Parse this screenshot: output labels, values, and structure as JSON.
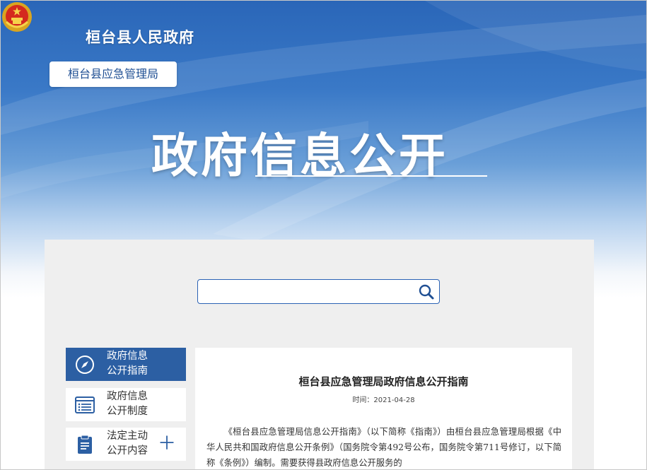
{
  "header": {
    "gov_name": "桓台县人民政府",
    "dept_name": "桓台县应急管理局",
    "hero_title": "政府信息公开"
  },
  "search": {
    "placeholder": "",
    "value": ""
  },
  "sidebar": {
    "items": [
      {
        "label": "政府信息公开指南",
        "icon": "compass-icon",
        "active": true
      },
      {
        "label": "政府信息公开制度",
        "icon": "list-icon",
        "active": false
      },
      {
        "label": "法定主动公开内容",
        "icon": "clipboard-icon",
        "active": false,
        "expand": "＋"
      }
    ]
  },
  "article": {
    "title": "桓台县应急管理局政府信息公开指南",
    "date": "时间：2021-04-28",
    "body": "《桓台县应急管理局信息公开指南》（以下简称《指南》）由桓台县应急管理局根据《中华人民共和国政府信息公开条例》（国务院令第492号公布，国务院令第711号修订，以下简称《条例》）编制。需要获得县政府信息公开服务的"
  },
  "colors": {
    "accent": "#2c5fa3",
    "banner_top": "#2a66b8",
    "panel_bg": "#efefef"
  }
}
